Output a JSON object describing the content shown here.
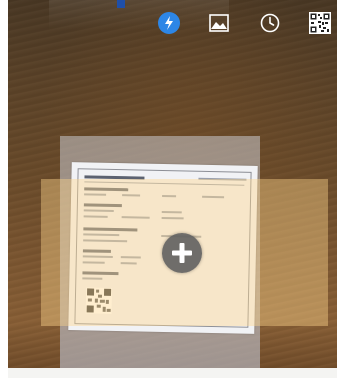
{
  "toolbar": {
    "buttons": [
      {
        "name": "flash",
        "icon": "flash-auto-icon",
        "active": true
      },
      {
        "name": "gallery",
        "icon": "image-gallery-icon",
        "active": false
      },
      {
        "name": "history",
        "icon": "clock-history-icon",
        "active": false
      },
      {
        "name": "qr",
        "icon": "qr-code-icon",
        "active": false
      }
    ],
    "accent_color": "#2d86e6"
  },
  "viewfinder": {
    "frame_color": "#ffd68c",
    "capture_icon": "plus-icon"
  }
}
